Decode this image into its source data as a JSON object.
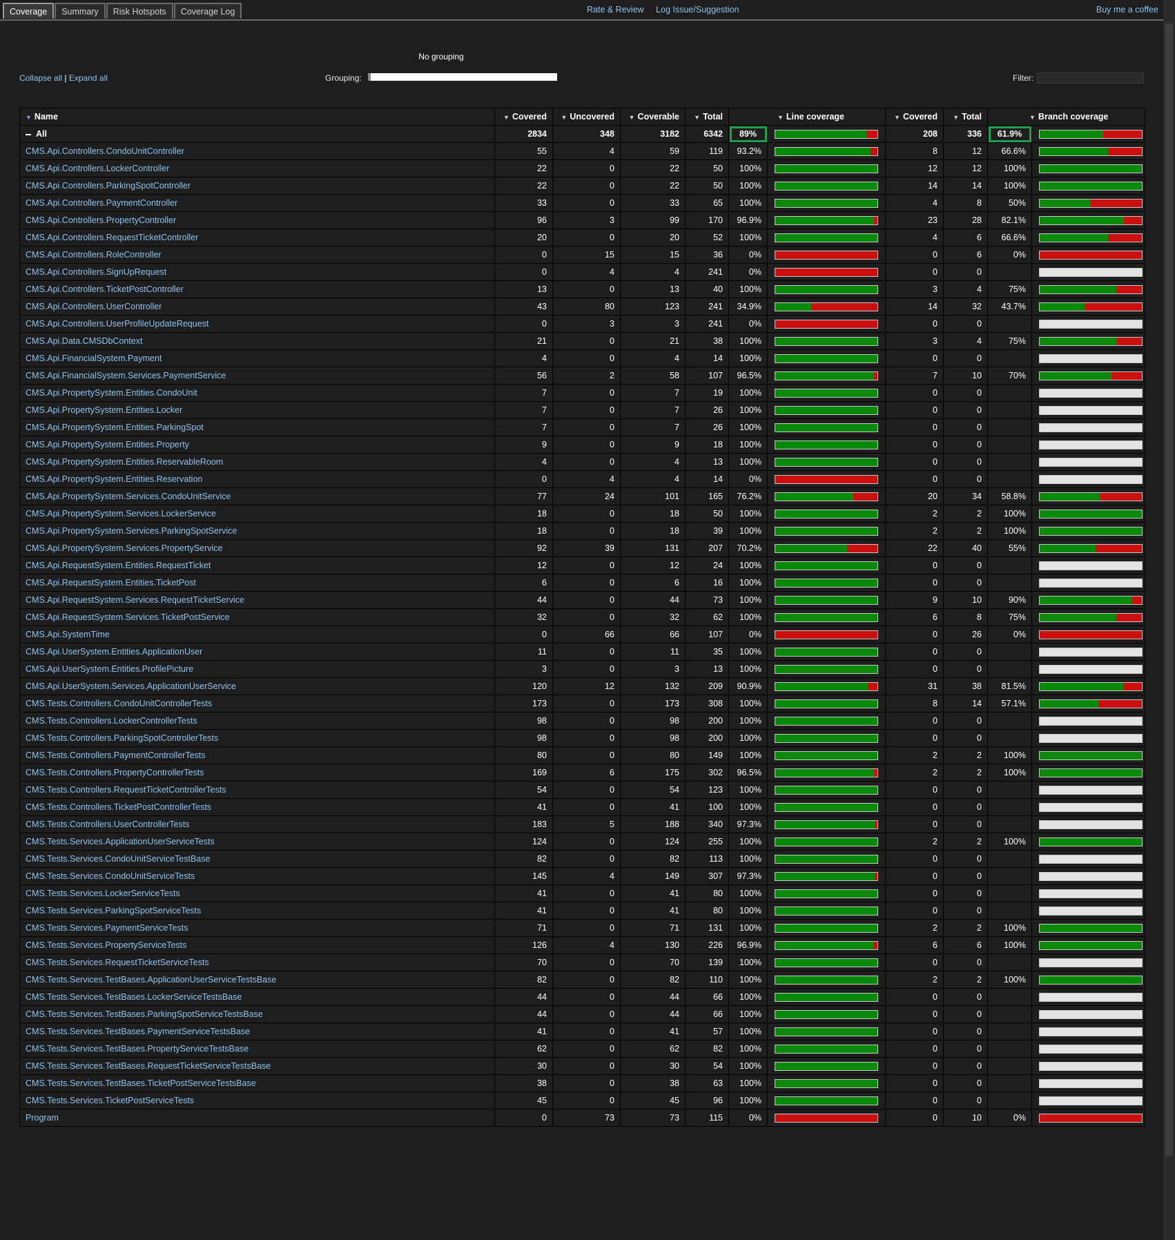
{
  "tabs": [
    "Coverage",
    "Summary",
    "Risk Hotspots",
    "Coverage Log"
  ],
  "top_links": [
    "Rate & Review",
    "Log Issue/Suggestion"
  ],
  "coffee_link": "Buy me a coffee",
  "grouping_title": "No grouping",
  "collapse_all": "Collapse all",
  "separator": "|",
  "expand_all": "Expand all",
  "grouping_label": "Grouping:",
  "filter_label": "Filter:",
  "columns": [
    "Name",
    "Covered",
    "Uncovered",
    "Coverable",
    "Total",
    "Line coverage",
    "Covered",
    "Total",
    "Branch coverage"
  ],
  "colors": {
    "covered": "#0a8a0a",
    "uncovered": "#cc0f0f",
    "no_branches": "#e3e3e3",
    "highlight": "#1fa14a",
    "link": "#8cc4f0"
  },
  "rows": [
    {
      "name": "All",
      "covered": "2834",
      "uncovered": "348",
      "coverable": "3182",
      "total": "6342",
      "line_pct": "89%",
      "line_frac": 0.89,
      "b_covered": "208",
      "b_total": "336",
      "branch_pct": "61.9%",
      "branch_frac": 0.619,
      "is_total": true
    },
    {
      "name": "CMS.Api.Controllers.CondoUnitController",
      "covered": "55",
      "uncovered": "4",
      "coverable": "59",
      "total": "119",
      "line_pct": "93.2%",
      "line_frac": 0.932,
      "b_covered": "8",
      "b_total": "12",
      "branch_pct": "66.6%",
      "branch_frac": 0.666
    },
    {
      "name": "CMS.Api.Controllers.LockerController",
      "covered": "22",
      "uncovered": "0",
      "coverable": "22",
      "total": "50",
      "line_pct": "100%",
      "line_frac": 1,
      "b_covered": "12",
      "b_total": "12",
      "branch_pct": "100%",
      "branch_frac": 1
    },
    {
      "name": "CMS.Api.Controllers.ParkingSpotController",
      "covered": "22",
      "uncovered": "0",
      "coverable": "22",
      "total": "50",
      "line_pct": "100%",
      "line_frac": 1,
      "b_covered": "14",
      "b_total": "14",
      "branch_pct": "100%",
      "branch_frac": 1
    },
    {
      "name": "CMS.Api.Controllers.PaymentController",
      "covered": "33",
      "uncovered": "0",
      "coverable": "33",
      "total": "65",
      "line_pct": "100%",
      "line_frac": 1,
      "b_covered": "4",
      "b_total": "8",
      "branch_pct": "50%",
      "branch_frac": 0.5
    },
    {
      "name": "CMS.Api.Controllers.PropertyController",
      "covered": "96",
      "uncovered": "3",
      "coverable": "99",
      "total": "170",
      "line_pct": "96.9%",
      "line_frac": 0.969,
      "b_covered": "23",
      "b_total": "28",
      "branch_pct": "82.1%",
      "branch_frac": 0.821
    },
    {
      "name": "CMS.Api.Controllers.RequestTicketController",
      "covered": "20",
      "uncovered": "0",
      "coverable": "20",
      "total": "52",
      "line_pct": "100%",
      "line_frac": 1,
      "b_covered": "4",
      "b_total": "6",
      "branch_pct": "66.6%",
      "branch_frac": 0.666
    },
    {
      "name": "CMS.Api.Controllers.RoleController",
      "covered": "0",
      "uncovered": "15",
      "coverable": "15",
      "total": "36",
      "line_pct": "0%",
      "line_frac": 0,
      "b_covered": "0",
      "b_total": "6",
      "branch_pct": "0%",
      "branch_frac": 0
    },
    {
      "name": "CMS.Api.Controllers.SignUpRequest",
      "covered": "0",
      "uncovered": "4",
      "coverable": "4",
      "total": "241",
      "line_pct": "0%",
      "line_frac": 0,
      "b_covered": "0",
      "b_total": "0",
      "branch_pct": "",
      "branch_frac": null
    },
    {
      "name": "CMS.Api.Controllers.TicketPostController",
      "covered": "13",
      "uncovered": "0",
      "coverable": "13",
      "total": "40",
      "line_pct": "100%",
      "line_frac": 1,
      "b_covered": "3",
      "b_total": "4",
      "branch_pct": "75%",
      "branch_frac": 0.75
    },
    {
      "name": "CMS.Api.Controllers.UserController",
      "covered": "43",
      "uncovered": "80",
      "coverable": "123",
      "total": "241",
      "line_pct": "34.9%",
      "line_frac": 0.349,
      "b_covered": "14",
      "b_total": "32",
      "branch_pct": "43.7%",
      "branch_frac": 0.437
    },
    {
      "name": "CMS.Api.Controllers.UserProfileUpdateRequest",
      "covered": "0",
      "uncovered": "3",
      "coverable": "3",
      "total": "241",
      "line_pct": "0%",
      "line_frac": 0,
      "b_covered": "0",
      "b_total": "0",
      "branch_pct": "",
      "branch_frac": null
    },
    {
      "name": "CMS.Api.Data.CMSDbContext",
      "covered": "21",
      "uncovered": "0",
      "coverable": "21",
      "total": "38",
      "line_pct": "100%",
      "line_frac": 1,
      "b_covered": "3",
      "b_total": "4",
      "branch_pct": "75%",
      "branch_frac": 0.75
    },
    {
      "name": "CMS.Api.FinancialSystem.Payment",
      "covered": "4",
      "uncovered": "0",
      "coverable": "4",
      "total": "14",
      "line_pct": "100%",
      "line_frac": 1,
      "b_covered": "0",
      "b_total": "0",
      "branch_pct": "",
      "branch_frac": null
    },
    {
      "name": "CMS.Api.FinancialSystem.Services.PaymentService",
      "covered": "56",
      "uncovered": "2",
      "coverable": "58",
      "total": "107",
      "line_pct": "96.5%",
      "line_frac": 0.965,
      "b_covered": "7",
      "b_total": "10",
      "branch_pct": "70%",
      "branch_frac": 0.7
    },
    {
      "name": "CMS.Api.PropertySystem.Entities.CondoUnit",
      "covered": "7",
      "uncovered": "0",
      "coverable": "7",
      "total": "19",
      "line_pct": "100%",
      "line_frac": 1,
      "b_covered": "0",
      "b_total": "0",
      "branch_pct": "",
      "branch_frac": null
    },
    {
      "name": "CMS.Api.PropertySystem.Entities.Locker",
      "covered": "7",
      "uncovered": "0",
      "coverable": "7",
      "total": "26",
      "line_pct": "100%",
      "line_frac": 1,
      "b_covered": "0",
      "b_total": "0",
      "branch_pct": "",
      "branch_frac": null
    },
    {
      "name": "CMS.Api.PropertySystem.Entities.ParkingSpot",
      "covered": "7",
      "uncovered": "0",
      "coverable": "7",
      "total": "26",
      "line_pct": "100%",
      "line_frac": 1,
      "b_covered": "0",
      "b_total": "0",
      "branch_pct": "",
      "branch_frac": null
    },
    {
      "name": "CMS.Api.PropertySystem.Entities.Property",
      "covered": "9",
      "uncovered": "0",
      "coverable": "9",
      "total": "18",
      "line_pct": "100%",
      "line_frac": 1,
      "b_covered": "0",
      "b_total": "0",
      "branch_pct": "",
      "branch_frac": null
    },
    {
      "name": "CMS.Api.PropertySystem.Entities.ReservableRoom",
      "covered": "4",
      "uncovered": "0",
      "coverable": "4",
      "total": "13",
      "line_pct": "100%",
      "line_frac": 1,
      "b_covered": "0",
      "b_total": "0",
      "branch_pct": "",
      "branch_frac": null
    },
    {
      "name": "CMS.Api.PropertySystem.Entities.Reservation",
      "covered": "0",
      "uncovered": "4",
      "coverable": "4",
      "total": "14",
      "line_pct": "0%",
      "line_frac": 0,
      "b_covered": "0",
      "b_total": "0",
      "branch_pct": "",
      "branch_frac": null
    },
    {
      "name": "CMS.Api.PropertySystem.Services.CondoUnitService",
      "covered": "77",
      "uncovered": "24",
      "coverable": "101",
      "total": "165",
      "line_pct": "76.2%",
      "line_frac": 0.762,
      "b_covered": "20",
      "b_total": "34",
      "branch_pct": "58.8%",
      "branch_frac": 0.588
    },
    {
      "name": "CMS.Api.PropertySystem.Services.LockerService",
      "covered": "18",
      "uncovered": "0",
      "coverable": "18",
      "total": "50",
      "line_pct": "100%",
      "line_frac": 1,
      "b_covered": "2",
      "b_total": "2",
      "branch_pct": "100%",
      "branch_frac": 1
    },
    {
      "name": "CMS.Api.PropertySystem.Services.ParkingSpotService",
      "covered": "18",
      "uncovered": "0",
      "coverable": "18",
      "total": "39",
      "line_pct": "100%",
      "line_frac": 1,
      "b_covered": "2",
      "b_total": "2",
      "branch_pct": "100%",
      "branch_frac": 1
    },
    {
      "name": "CMS.Api.PropertySystem.Services.PropertyService",
      "covered": "92",
      "uncovered": "39",
      "coverable": "131",
      "total": "207",
      "line_pct": "70.2%",
      "line_frac": 0.702,
      "b_covered": "22",
      "b_total": "40",
      "branch_pct": "55%",
      "branch_frac": 0.55
    },
    {
      "name": "CMS.Api.RequestSystem.Entities.RequestTicket",
      "covered": "12",
      "uncovered": "0",
      "coverable": "12",
      "total": "24",
      "line_pct": "100%",
      "line_frac": 1,
      "b_covered": "0",
      "b_total": "0",
      "branch_pct": "",
      "branch_frac": null
    },
    {
      "name": "CMS.Api.RequestSystem.Entities.TicketPost",
      "covered": "6",
      "uncovered": "0",
      "coverable": "6",
      "total": "16",
      "line_pct": "100%",
      "line_frac": 1,
      "b_covered": "0",
      "b_total": "0",
      "branch_pct": "",
      "branch_frac": null
    },
    {
      "name": "CMS.Api.RequestSystem.Services.RequestTicketService",
      "covered": "44",
      "uncovered": "0",
      "coverable": "44",
      "total": "73",
      "line_pct": "100%",
      "line_frac": 1,
      "b_covered": "9",
      "b_total": "10",
      "branch_pct": "90%",
      "branch_frac": 0.9
    },
    {
      "name": "CMS.Api.RequestSystem.Services.TicketPostService",
      "covered": "32",
      "uncovered": "0",
      "coverable": "32",
      "total": "62",
      "line_pct": "100%",
      "line_frac": 1,
      "b_covered": "6",
      "b_total": "8",
      "branch_pct": "75%",
      "branch_frac": 0.75
    },
    {
      "name": "CMS.Api.SystemTime",
      "covered": "0",
      "uncovered": "66",
      "coverable": "66",
      "total": "107",
      "line_pct": "0%",
      "line_frac": 0,
      "b_covered": "0",
      "b_total": "26",
      "branch_pct": "0%",
      "branch_frac": 0
    },
    {
      "name": "CMS.Api.UserSystem.Entities.ApplicationUser",
      "covered": "11",
      "uncovered": "0",
      "coverable": "11",
      "total": "35",
      "line_pct": "100%",
      "line_frac": 1,
      "b_covered": "0",
      "b_total": "0",
      "branch_pct": "",
      "branch_frac": null
    },
    {
      "name": "CMS.Api.UserSystem.Entities.ProfilePicture",
      "covered": "3",
      "uncovered": "0",
      "coverable": "3",
      "total": "13",
      "line_pct": "100%",
      "line_frac": 1,
      "b_covered": "0",
      "b_total": "0",
      "branch_pct": "",
      "branch_frac": null
    },
    {
      "name": "CMS.Api.UserSystem.Services.ApplicationUserService",
      "covered": "120",
      "uncovered": "12",
      "coverable": "132",
      "total": "209",
      "line_pct": "90.9%",
      "line_frac": 0.909,
      "b_covered": "31",
      "b_total": "38",
      "branch_pct": "81.5%",
      "branch_frac": 0.815
    },
    {
      "name": "CMS.Tests.Controllers.CondoUnitControllerTests",
      "covered": "173",
      "uncovered": "0",
      "coverable": "173",
      "total": "308",
      "line_pct": "100%",
      "line_frac": 1,
      "b_covered": "8",
      "b_total": "14",
      "branch_pct": "57.1%",
      "branch_frac": 0.571
    },
    {
      "name": "CMS.Tests.Controllers.LockerControllerTests",
      "covered": "98",
      "uncovered": "0",
      "coverable": "98",
      "total": "200",
      "line_pct": "100%",
      "line_frac": 1,
      "b_covered": "0",
      "b_total": "0",
      "branch_pct": "",
      "branch_frac": null
    },
    {
      "name": "CMS.Tests.Controllers.ParkingSpotControllerTests",
      "covered": "98",
      "uncovered": "0",
      "coverable": "98",
      "total": "200",
      "line_pct": "100%",
      "line_frac": 1,
      "b_covered": "0",
      "b_total": "0",
      "branch_pct": "",
      "branch_frac": null
    },
    {
      "name": "CMS.Tests.Controllers.PaymentControllerTests",
      "covered": "80",
      "uncovered": "0",
      "coverable": "80",
      "total": "149",
      "line_pct": "100%",
      "line_frac": 1,
      "b_covered": "2",
      "b_total": "2",
      "branch_pct": "100%",
      "branch_frac": 1
    },
    {
      "name": "CMS.Tests.Controllers.PropertyControllerTests",
      "covered": "169",
      "uncovered": "6",
      "coverable": "175",
      "total": "302",
      "line_pct": "96.5%",
      "line_frac": 0.965,
      "b_covered": "2",
      "b_total": "2",
      "branch_pct": "100%",
      "branch_frac": 1
    },
    {
      "name": "CMS.Tests.Controllers.RequestTicketControllerTests",
      "covered": "54",
      "uncovered": "0",
      "coverable": "54",
      "total": "123",
      "line_pct": "100%",
      "line_frac": 1,
      "b_covered": "0",
      "b_total": "0",
      "branch_pct": "",
      "branch_frac": null
    },
    {
      "name": "CMS.Tests.Controllers.TicketPostControllerTests",
      "covered": "41",
      "uncovered": "0",
      "coverable": "41",
      "total": "100",
      "line_pct": "100%",
      "line_frac": 1,
      "b_covered": "0",
      "b_total": "0",
      "branch_pct": "",
      "branch_frac": null
    },
    {
      "name": "CMS.Tests.Controllers.UserControllerTests",
      "covered": "183",
      "uncovered": "5",
      "coverable": "188",
      "total": "340",
      "line_pct": "97.3%",
      "line_frac": 0.973,
      "b_covered": "0",
      "b_total": "0",
      "branch_pct": "",
      "branch_frac": null
    },
    {
      "name": "CMS.Tests.Services.ApplicationUserServiceTests",
      "covered": "124",
      "uncovered": "0",
      "coverable": "124",
      "total": "255",
      "line_pct": "100%",
      "line_frac": 1,
      "b_covered": "2",
      "b_total": "2",
      "branch_pct": "100%",
      "branch_frac": 1
    },
    {
      "name": "CMS.Tests.Services.CondoUnitServiceTestBase",
      "covered": "82",
      "uncovered": "0",
      "coverable": "82",
      "total": "113",
      "line_pct": "100%",
      "line_frac": 1,
      "b_covered": "0",
      "b_total": "0",
      "branch_pct": "",
      "branch_frac": null
    },
    {
      "name": "CMS.Tests.Services.CondoUnitServiceTests",
      "covered": "145",
      "uncovered": "4",
      "coverable": "149",
      "total": "307",
      "line_pct": "97.3%",
      "line_frac": 0.973,
      "b_covered": "0",
      "b_total": "0",
      "branch_pct": "",
      "branch_frac": null
    },
    {
      "name": "CMS.Tests.Services.LockerServiceTests",
      "covered": "41",
      "uncovered": "0",
      "coverable": "41",
      "total": "80",
      "line_pct": "100%",
      "line_frac": 1,
      "b_covered": "0",
      "b_total": "0",
      "branch_pct": "",
      "branch_frac": null
    },
    {
      "name": "CMS.Tests.Services.ParkingSpotServiceTests",
      "covered": "41",
      "uncovered": "0",
      "coverable": "41",
      "total": "80",
      "line_pct": "100%",
      "line_frac": 1,
      "b_covered": "0",
      "b_total": "0",
      "branch_pct": "",
      "branch_frac": null
    },
    {
      "name": "CMS.Tests.Services.PaymentServiceTests",
      "covered": "71",
      "uncovered": "0",
      "coverable": "71",
      "total": "131",
      "line_pct": "100%",
      "line_frac": 1,
      "b_covered": "2",
      "b_total": "2",
      "branch_pct": "100%",
      "branch_frac": 1
    },
    {
      "name": "CMS.Tests.Services.PropertyServiceTests",
      "covered": "126",
      "uncovered": "4",
      "coverable": "130",
      "total": "226",
      "line_pct": "96.9%",
      "line_frac": 0.969,
      "b_covered": "6",
      "b_total": "6",
      "branch_pct": "100%",
      "branch_frac": 1
    },
    {
      "name": "CMS.Tests.Services.RequestTicketServiceTests",
      "covered": "70",
      "uncovered": "0",
      "coverable": "70",
      "total": "139",
      "line_pct": "100%",
      "line_frac": 1,
      "b_covered": "0",
      "b_total": "0",
      "branch_pct": "",
      "branch_frac": null
    },
    {
      "name": "CMS.Tests.Services.TestBases.ApplicationUserServiceTestsBase",
      "covered": "82",
      "uncovered": "0",
      "coverable": "82",
      "total": "110",
      "line_pct": "100%",
      "line_frac": 1,
      "b_covered": "2",
      "b_total": "2",
      "branch_pct": "100%",
      "branch_frac": 1
    },
    {
      "name": "CMS.Tests.Services.TestBases.LockerServiceTestsBase",
      "covered": "44",
      "uncovered": "0",
      "coverable": "44",
      "total": "66",
      "line_pct": "100%",
      "line_frac": 1,
      "b_covered": "0",
      "b_total": "0",
      "branch_pct": "",
      "branch_frac": null
    },
    {
      "name": "CMS.Tests.Services.TestBases.ParkingSpotServiceTestsBase",
      "covered": "44",
      "uncovered": "0",
      "coverable": "44",
      "total": "66",
      "line_pct": "100%",
      "line_frac": 1,
      "b_covered": "0",
      "b_total": "0",
      "branch_pct": "",
      "branch_frac": null
    },
    {
      "name": "CMS.Tests.Services.TestBases.PaymentServiceTestsBase",
      "covered": "41",
      "uncovered": "0",
      "coverable": "41",
      "total": "57",
      "line_pct": "100%",
      "line_frac": 1,
      "b_covered": "0",
      "b_total": "0",
      "branch_pct": "",
      "branch_frac": null
    },
    {
      "name": "CMS.Tests.Services.TestBases.PropertyServiceTestsBase",
      "covered": "62",
      "uncovered": "0",
      "coverable": "62",
      "total": "82",
      "line_pct": "100%",
      "line_frac": 1,
      "b_covered": "0",
      "b_total": "0",
      "branch_pct": "",
      "branch_frac": null
    },
    {
      "name": "CMS.Tests.Services.TestBases.RequestTicketServiceTestsBase",
      "covered": "30",
      "uncovered": "0",
      "coverable": "30",
      "total": "54",
      "line_pct": "100%",
      "line_frac": 1,
      "b_covered": "0",
      "b_total": "0",
      "branch_pct": "",
      "branch_frac": null
    },
    {
      "name": "CMS.Tests.Services.TestBases.TicketPostServiceTestsBase",
      "covered": "38",
      "uncovered": "0",
      "coverable": "38",
      "total": "63",
      "line_pct": "100%",
      "line_frac": 1,
      "b_covered": "0",
      "b_total": "0",
      "branch_pct": "",
      "branch_frac": null
    },
    {
      "name": "CMS.Tests.Services.TicketPostServiceTests",
      "covered": "45",
      "uncovered": "0",
      "coverable": "45",
      "total": "96",
      "line_pct": "100%",
      "line_frac": 1,
      "b_covered": "0",
      "b_total": "0",
      "branch_pct": "",
      "branch_frac": null
    },
    {
      "name": "Program",
      "covered": "0",
      "uncovered": "73",
      "coverable": "73",
      "total": "115",
      "line_pct": "0%",
      "line_frac": 0,
      "b_covered": "0",
      "b_total": "10",
      "branch_pct": "0%",
      "branch_frac": 0
    }
  ]
}
